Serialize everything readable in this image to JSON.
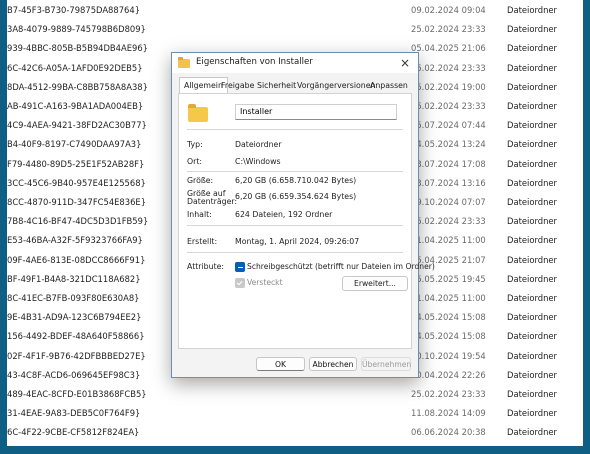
{
  "list": {
    "rows": [
      {
        "guid": "B7-45F3-B730-79875DA88764}",
        "date": "09.02.2024 09:04",
        "type": "Dateiordner"
      },
      {
        "guid": "3A8-4079-9889-745798B6D809}",
        "date": "25.02.2024 23:33",
        "type": "Dateiordner"
      },
      {
        "guid": "939-4BBC-805B-B5B94DB4AE96}",
        "date": "05.04.2025 21:06",
        "type": "Dateiordner"
      },
      {
        "guid": "6C-42C6-A05A-1AFD0E92DEB5}",
        "date": "25.02.2024 23:33",
        "type": "Dateiordner"
      },
      {
        "guid": "8DA-4512-99BA-C8BB758A8A38}",
        "date": "25.02.2024 19:00",
        "type": "Dateiordner"
      },
      {
        "guid": "AB-491C-A163-9BA1ADA004EB}",
        "date": "25.02.2024 23:33",
        "type": "Dateiordner"
      },
      {
        "guid": "4C9-4AEA-9421-38FD2AC30B77}",
        "date": "25.07.2024 07:44",
        "type": "Dateiordner"
      },
      {
        "guid": "B4-40F9-8197-C7490DAA97A3}",
        "date": "24.05.2024 13:24",
        "type": "Dateiordner"
      },
      {
        "guid": "F79-4480-89D5-25E1F52AB28F}",
        "date": "23.07.2024 17:08",
        "type": "Dateiordner"
      },
      {
        "guid": "3CC-45C6-9B40-957E4E125568}",
        "date": "23.07.2024 13:16",
        "type": "Dateiordner"
      },
      {
        "guid": "8CC-4870-911D-347FC54E836E}",
        "date": "29.10.2024 07:07",
        "type": "Dateiordner"
      },
      {
        "guid": "7B8-4C16-BF47-4DC5D3D1FB59}",
        "date": "25.02.2024 23:33",
        "type": "Dateiordner"
      },
      {
        "guid": "E53-46BA-A32F-5F9323766FA9}",
        "date": "11.04.2025 11:00",
        "type": "Dateiordner"
      },
      {
        "guid": "09F-4AE6-813E-08DCC8666F91}",
        "date": "15.04.2025 21:07",
        "type": "Dateiordner"
      },
      {
        "guid": "BF-49F1-B4A8-321DC118A682}",
        "date": "25.05.2025 19:45",
        "type": "Dateiordner"
      },
      {
        "guid": "8C-41EC-B7FB-093F80E630A8}",
        "date": "11.04.2025 11:00",
        "type": "Dateiordner"
      },
      {
        "guid": "9E-4B31-AD9A-123C6B794EE2}",
        "date": "24.05.2024 15:08",
        "type": "Dateiordner"
      },
      {
        "guid": "156-4492-BDEF-48A640F58866}",
        "date": "24.05.2024 15:08",
        "type": "Dateiordner"
      },
      {
        "guid": "02F-4F1F-9B76-42DFBBBED27E}",
        "date": "20.10.2024 19:54",
        "type": "Dateiordner"
      },
      {
        "guid": "43-4C8F-ACD6-069645EF98C3}",
        "date": "30.04.2024 22:26",
        "type": "Dateiordner"
      },
      {
        "guid": "489-4EAC-8CFD-E01B3868FCB5}",
        "date": "25.02.2024 23:33",
        "type": "Dateiordner"
      },
      {
        "guid": "31-4EAE-9A83-DEB5C0F764F9}",
        "date": "11.08.2024 14:09",
        "type": "Dateiordner"
      },
      {
        "guid": "6C-4F22-9CBE-CF5812F824EA}",
        "date": "06.06.2024 20:38",
        "type": "Dateiordner"
      }
    ]
  },
  "dialog": {
    "title": "Eigenschaften von Installer",
    "close_icon": "×",
    "tabs": [
      "Allgemein",
      "Freigabe",
      "Sicherheit",
      "Vorgängerversionen",
      "Anpassen"
    ],
    "name_value": "Installer",
    "typ_label": "Typ:",
    "typ_value": "Dateiordner",
    "ort_label": "Ort:",
    "ort_value": "C:\\Windows",
    "groesse_label": "Größe:",
    "groesse_value": "6,20 GB (6.658.710.042 Bytes)",
    "groesse_auf_label_1": "Größe auf",
    "groesse_auf_label_2": "Datenträger:",
    "groesse_auf_value": "6,20 GB (6.659.354.624 Bytes)",
    "inhalt_label": "Inhalt:",
    "inhalt_value": "624 Dateien, 192 Ordner",
    "erstellt_label": "Erstellt:",
    "erstellt_value": "Montag, 1. April 2024, 09:26:07",
    "attribute_label": "Attribute:",
    "readonly_label": "Schreibgeschützt (betrifft nur Dateien im Ordner)",
    "hidden_label": "Versteckt",
    "advanced_label": "Erweitert...",
    "ok_label": "OK",
    "cancel_label": "Abbrechen",
    "apply_label": "Übernehmen"
  }
}
